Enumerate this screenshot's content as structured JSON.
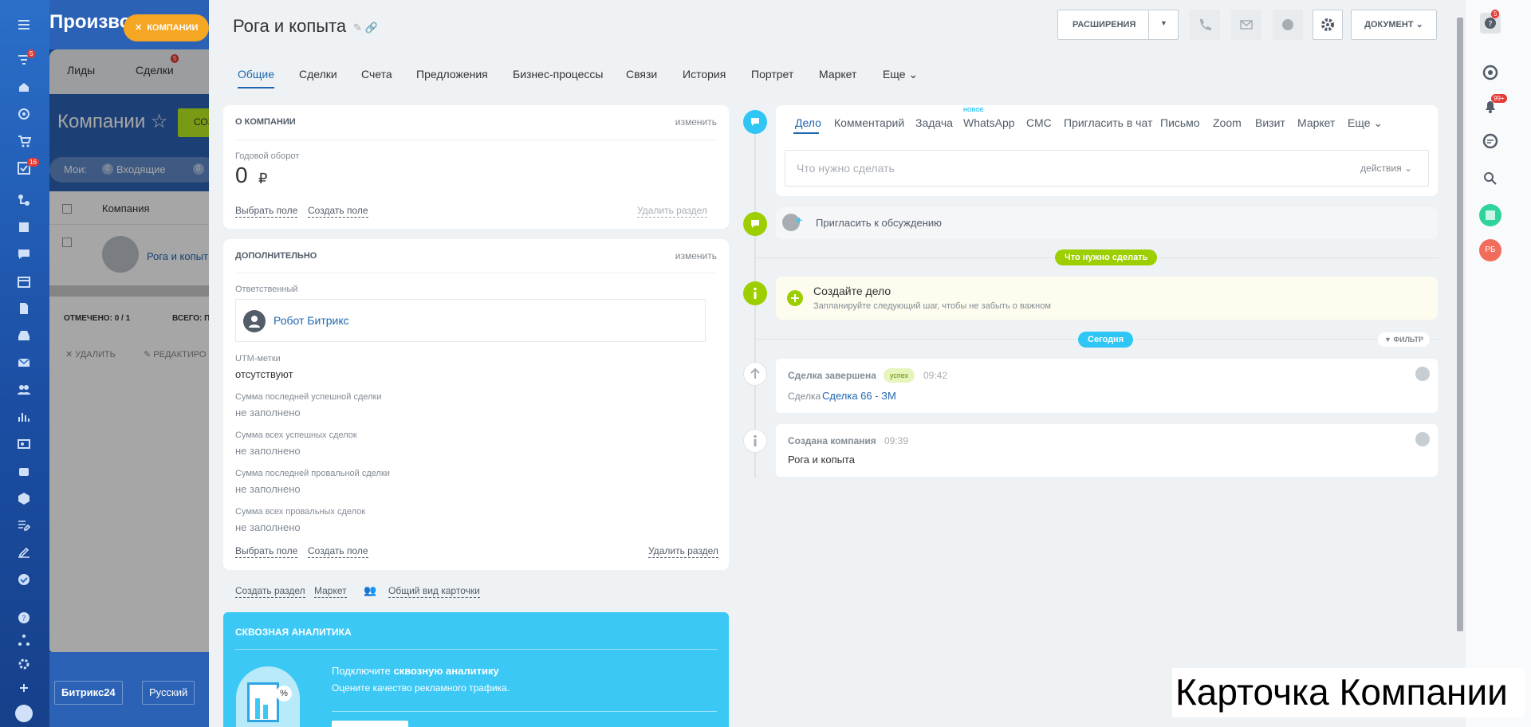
{
  "leftnav": {
    "badges": {
      "filter": "5",
      "tasks": "16"
    },
    "icons": [
      "menu-icon",
      "filter-icon",
      "home-icon",
      "target-icon",
      "cart-icon",
      "tasks-icon",
      "funnel-icon",
      "list-icon",
      "chat-icon",
      "calendar-icon",
      "document-icon",
      "inbox-icon",
      "mail-icon",
      "group-icon",
      "chart-icon",
      "contact-card-icon",
      "robot-icon",
      "box-icon",
      "edit-list-icon",
      "sign-icon",
      "check-circle-icon",
      "help-icon",
      "sitemap-icon",
      "settings-icon",
      "plus-icon",
      "crown-icon"
    ]
  },
  "background": {
    "portal_title": "Производ",
    "company_pill": "КОМПАНИИ",
    "topbar": {
      "leads": "Лиды",
      "deals": "Сделки",
      "deals_badge": "5"
    },
    "page_title": "Компании",
    "create_button": "СОЗ",
    "filter": {
      "my": "Мои:",
      "incoming_count": "0",
      "incoming": "Входящие",
      "next_count": "0"
    },
    "grid": {
      "column_company": "Компания",
      "row_name": "Рога и копыт",
      "marked": "ОТМЕЧЕНО: 0 / 1",
      "total": "ВСЕГО: П"
    },
    "actions": {
      "delete": "УДАЛИТЬ",
      "edit": "РЕДАКТИРО"
    },
    "bottom": {
      "brand": "Битрикс24",
      "lang": "Русский"
    }
  },
  "header": {
    "title": "Рога и копыта",
    "extensions": "РАСШИРЕНИЯ",
    "document": "ДОКУМЕНТ"
  },
  "tabs": [
    "Общие",
    "Сделки",
    "Счета",
    "Предложения",
    "Бизнес-процессы",
    "Связи",
    "История",
    "Портрет",
    "Маркет",
    "Еще"
  ],
  "about": {
    "title": "О КОМПАНИИ",
    "edit": "изменить",
    "revenue_label": "Годовой оборот",
    "revenue_value": "0",
    "currency": "₽",
    "select_field": "Выбрать поле",
    "create_field": "Создать поле",
    "delete_section": "Удалить раздел"
  },
  "extra": {
    "title": "ДОПОЛНИТЕЛЬНО",
    "edit": "изменить",
    "responsible_label": "Ответственный",
    "responsible_name": "Робот Битрикс",
    "utm_label": "UTM-метки",
    "utm_value": "отсутствуют",
    "fields": [
      {
        "label": "Сумма последней успешной сделки",
        "value": "не заполнено"
      },
      {
        "label": "Сумма всех успешных сделок",
        "value": "не заполнено"
      },
      {
        "label": "Сумма последней провальной сделки",
        "value": "не заполнено"
      },
      {
        "label": "Сумма всех провальных сделок",
        "value": "не заполнено"
      }
    ],
    "select_field": "Выбрать поле",
    "create_field": "Создать поле",
    "delete_section": "Удалить раздел"
  },
  "bottom_links": {
    "create_section": "Создать раздел",
    "market": "Маркет",
    "common_view": "Общий вид карточки"
  },
  "analytics": {
    "title": "СКВОЗНАЯ АНАЛИТИКА",
    "connect_prefix": "Подключите ",
    "connect_bold": "сквозную аналитику",
    "subtitle": "Оцените качество рекламного трафика."
  },
  "activity": {
    "tabs": [
      "Дело",
      "Комментарий",
      "Задача",
      "WhatsApp",
      "СМС",
      "Пригласить в чат",
      "Письмо",
      "Zoom",
      "Визит",
      "Маркет",
      "Еще"
    ],
    "new_badge": "НОВОЕ",
    "input_placeholder": "Что нужно сделать",
    "actions": "действия",
    "invite": "Пригласить к обсуждению"
  },
  "timeline": {
    "todo_pill": "Что нужно сделать",
    "create_title": "Создайте дело",
    "create_sub": "Запланируйте следующий шаг, чтобы не забыть о важном",
    "today_pill": "Сегодня",
    "filter": "ФИЛЬТР",
    "items": [
      {
        "title": "Сделка завершена",
        "badge": "успех",
        "time": "09:42",
        "prefix": "Сделка",
        "link": "Сделка 66 - ЗМ"
      },
      {
        "title": "Создана компания",
        "time": "09:39",
        "text": "Рога и копыта"
      }
    ]
  },
  "rail": {
    "help_badge": "5",
    "notif_badge": "99+",
    "avatar": "РБ"
  },
  "caption": "Карточка Компании",
  "colors": {
    "accent": "#2067b0",
    "green": "#9dcf00",
    "blue_pill": "#2fc6f6",
    "analytics": "#3bc8f5"
  }
}
